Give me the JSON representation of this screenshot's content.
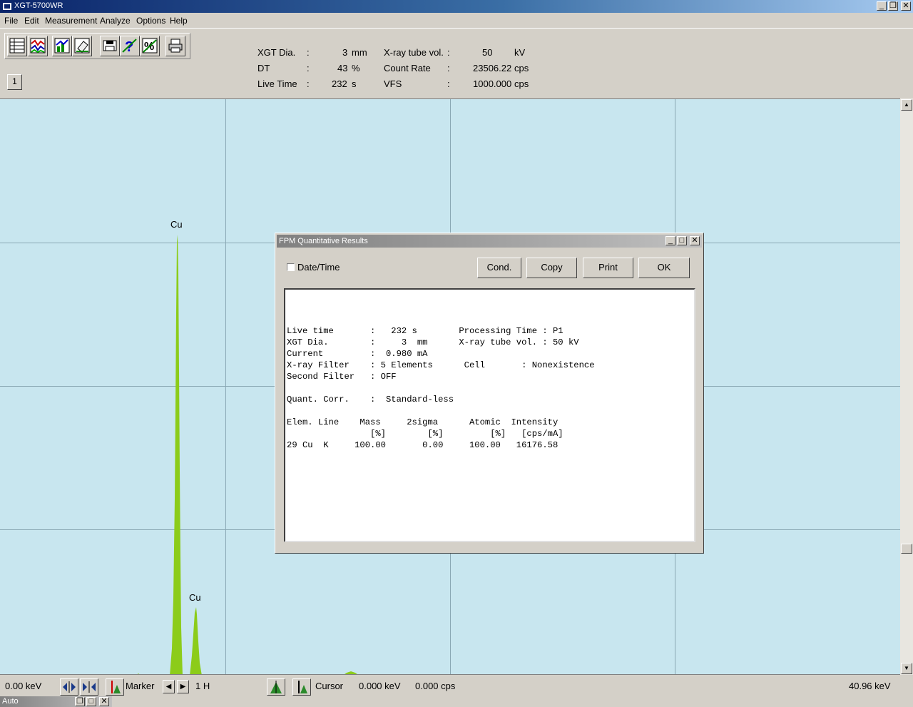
{
  "window": {
    "title": "XGT-5700WR",
    "app_icon": "app-icon"
  },
  "menu": [
    "File",
    "Edit",
    "Measurement",
    "Analyze",
    "Options",
    "Help"
  ],
  "toolbar": {
    "icons": [
      "table-icon",
      "spectrum-icon",
      "chart-icon",
      "eraser-icon",
      "save-icon",
      "help-icon",
      "percent-icon",
      "print-icon"
    ],
    "page_button": "1"
  },
  "info": {
    "xgt_label": "XGT Dia.",
    "xgt_value": "3",
    "xgt_unit": "mm",
    "dt_label": "DT",
    "dt_value": "43",
    "dt_unit": "%",
    "live_label": "Live Time",
    "live_value": "232",
    "live_unit": "s",
    "tube_label": "X-ray tube vol.",
    "tube_value": "50",
    "tube_unit": "kV",
    "count_label": "Count Rate",
    "count_value": "23506.22",
    "count_unit": "cps",
    "vfs_label": "VFS",
    "vfs_value": "1000.000",
    "vfs_unit": "cps",
    "colon": ":"
  },
  "spectrum": {
    "peak1_label": "Cu",
    "peak2_label": "Cu",
    "fill_color": "#8ccc1a",
    "background_color": "#c8e6ef"
  },
  "status": {
    "min_kev": "0.00 keV",
    "max_kev": "40.96 keV",
    "marker_label": "Marker",
    "marker_value": "1 H",
    "cursor_label": "Cursor",
    "cursor_kev": "0.000 keV",
    "cursor_cps": "0.000 cps"
  },
  "minimized": {
    "title": "Auto"
  },
  "dialog": {
    "title": "FPM Quantitative Results",
    "datetime_label": "Date/Time",
    "datetime_checked": false,
    "buttons": {
      "cond": "Cond.",
      "copy": "Copy",
      "print": "Print",
      "ok": "OK"
    },
    "report": "Live time       :   232 s        Processing Time : P1\nXGT Dia.        :     3  mm      X-ray tube vol. : 50 kV\nCurrent         :  0.980 mA\nX-ray Filter    : 5 Elements      Cell       : Nonexistence\nSecond Filter   : OFF\n\nQuant. Corr.    :  Standard-less\n\nElem. Line    Mass     2sigma      Atomic  Intensity\n                [%]        [%]         [%]   [cps/mA]\n29 Cu  K     100.00       0.00     100.00   16176.58"
  }
}
